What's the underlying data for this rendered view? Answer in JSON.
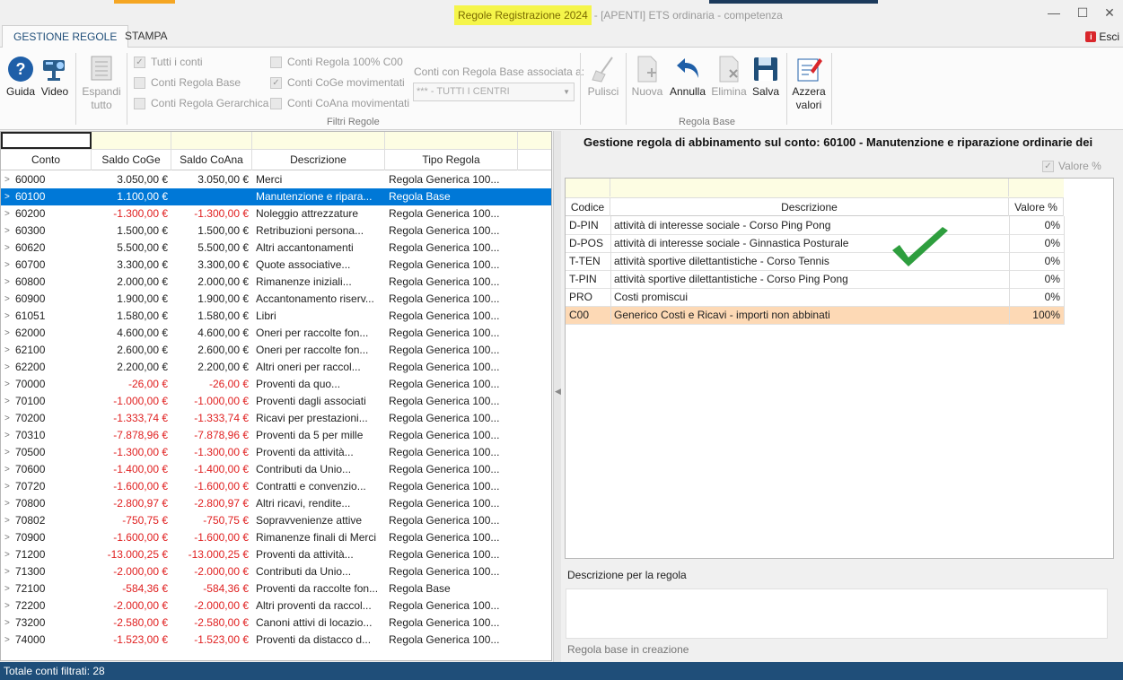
{
  "window": {
    "title_highlight": "Regole Registrazione 2024",
    "title_rest": "- [APENTI] ETS ordinaria - competenza",
    "minimize": "—",
    "maximize": "☐",
    "close": "✕"
  },
  "tabs": [
    {
      "label": "GESTIONE REGOLE",
      "active": true
    },
    {
      "label": "STAMPA",
      "active": false
    }
  ],
  "esci": {
    "label": "Esci",
    "icon": "exit-icon",
    "glyph": "i"
  },
  "ribbon": {
    "guida": "Guida",
    "video": "Video",
    "espandi_line1": "Espandi",
    "espandi_line2": "tutto",
    "filters": {
      "tutti_i_conti": "Tutti i conti",
      "conti_regola_base": "Conti Regola Base",
      "conti_regola_gerarchica": "Conti Regola Gerarchica",
      "conti_regola_100": "Conti Regola 100% C00",
      "conti_coge_mov": "Conti CoGe movimentati",
      "conti_coana_mov": "Conti CoAna movimentati",
      "combo_label": "Conti con Regola Base associata a:",
      "combo_value": "*** - TUTTI I CENTRI",
      "group_label": "Filtri Regole"
    },
    "pulisci": "Pulisci",
    "nuova": "Nuova",
    "annulla": "Annulla",
    "elimina": "Elimina",
    "salva": "Salva",
    "regola_base_group": "Regola Base",
    "azzera_line1": "Azzera",
    "azzera_line2": "valori"
  },
  "grid": {
    "headers": {
      "conto": "Conto",
      "saldo_coge": "Saldo CoGe",
      "saldo_coana": "Saldo CoAna",
      "descrizione": "Descrizione",
      "tipo_regola": "Tipo Regola"
    },
    "rows": [
      {
        "conto": "60000",
        "coge": "3.050,00 €",
        "coana": "3.050,00 €",
        "desc": "Merci",
        "tipo": "Regola Generica 100...",
        "neg": false,
        "exp": ">"
      },
      {
        "conto": "60100",
        "coge": "1.100,00 €",
        "coana": "",
        "desc": "Manutenzione  e  ripara...",
        "tipo": "Regola Base",
        "neg": false,
        "exp": ">",
        "selected": true
      },
      {
        "conto": "60200",
        "coge": "-1.300,00 €",
        "coana": "-1.300,00 €",
        "desc": "Noleggio attrezzature",
        "tipo": "Regola Generica 100...",
        "neg": true,
        "exp": ">"
      },
      {
        "conto": "60300",
        "coge": "1.500,00 €",
        "coana": "1.500,00 €",
        "desc": "Retribuzioni  persona...",
        "tipo": "Regola Generica 100...",
        "neg": false,
        "exp": ">"
      },
      {
        "conto": "60620",
        "coge": "5.500,00 €",
        "coana": "5.500,00 €",
        "desc": "Altri accantonamenti",
        "tipo": "Regola Generica 100...",
        "neg": false,
        "exp": ">"
      },
      {
        "conto": "60700",
        "coge": "3.300,00 €",
        "coana": "3.300,00 €",
        "desc": "Quote associative...",
        "tipo": "Regola Generica 100...",
        "neg": false,
        "exp": ">"
      },
      {
        "conto": "60800",
        "coge": "2.000,00 €",
        "coana": "2.000,00 €",
        "desc": "Rimanenze  iniziali...",
        "tipo": "Regola Generica 100...",
        "neg": false,
        "exp": ">"
      },
      {
        "conto": "60900",
        "coge": "1.900,00 €",
        "coana": "1.900,00 €",
        "desc": "Accantonamento  riserv...",
        "tipo": "Regola Generica 100...",
        "neg": false,
        "exp": ">"
      },
      {
        "conto": "61051",
        "coge": "1.580,00 €",
        "coana": "1.580,00 €",
        "desc": "Libri",
        "tipo": "Regola Generica 100...",
        "neg": false,
        "exp": ">"
      },
      {
        "conto": "62000",
        "coge": "4.600,00 €",
        "coana": "4.600,00 €",
        "desc": "Oneri  per raccolte  fon...",
        "tipo": "Regola Generica 100...",
        "neg": false,
        "exp": ">"
      },
      {
        "conto": "62100",
        "coge": "2.600,00 €",
        "coana": "2.600,00 €",
        "desc": "Oneri per raccolte fon...",
        "tipo": "Regola Generica 100...",
        "neg": false,
        "exp": ">"
      },
      {
        "conto": "62200",
        "coge": "2.200,00 €",
        "coana": "2.200,00 €",
        "desc": "Altri oneri per raccol...",
        "tipo": "Regola Generica 100...",
        "neg": false,
        "exp": ">"
      },
      {
        "conto": "70000",
        "coge": "-26,00 €",
        "coana": "-26,00 €",
        "desc": "Proventi  da quo...",
        "tipo": "Regola Generica 100...",
        "neg": true,
        "exp": ">"
      },
      {
        "conto": "70100",
        "coge": "-1.000,00 €",
        "coana": "-1.000,00 €",
        "desc": "Proventi dagli associati",
        "tipo": "Regola Generica 100...",
        "neg": true,
        "exp": ">"
      },
      {
        "conto": "70200",
        "coge": "-1.333,74 €",
        "coana": "-1.333,74 €",
        "desc": "Ricavi  per  prestazioni...",
        "tipo": "Regola Generica 100...",
        "neg": true,
        "exp": ">"
      },
      {
        "conto": "70310",
        "coge": "-7.878,96 €",
        "coana": "-7.878,96 €",
        "desc": "Proventi  da 5 per mille",
        "tipo": "Regola Generica 100...",
        "neg": true,
        "exp": ">"
      },
      {
        "conto": "70500",
        "coge": "-1.300,00 €",
        "coana": "-1.300,00 €",
        "desc": "Proventi  da attività...",
        "tipo": "Regola Generica 100...",
        "neg": true,
        "exp": ">"
      },
      {
        "conto": "70600",
        "coge": "-1.400,00 €",
        "coana": "-1.400,00 €",
        "desc": "Contributi  da Unio...",
        "tipo": "Regola Generica 100...",
        "neg": true,
        "exp": ">"
      },
      {
        "conto": "70720",
        "coge": "-1.600,00 €",
        "coana": "-1.600,00 €",
        "desc": "Contratti  e  convenzio...",
        "tipo": "Regola Generica 100...",
        "neg": true,
        "exp": ">"
      },
      {
        "conto": "70800",
        "coge": "-2.800,97 €",
        "coana": "-2.800,97 €",
        "desc": "Altri  ricavi,  rendite...",
        "tipo": "Regola Generica 100...",
        "neg": true,
        "exp": ">"
      },
      {
        "conto": "70802",
        "coge": "-750,75 €",
        "coana": "-750,75 €",
        "desc": "Sopravvenienze attive",
        "tipo": "Regola Generica 100...",
        "neg": true,
        "exp": ">"
      },
      {
        "conto": "70900",
        "coge": "-1.600,00 €",
        "coana": "-1.600,00 €",
        "desc": "Rimanenze finali di Merci",
        "tipo": "Regola Generica 100...",
        "neg": true,
        "exp": ">"
      },
      {
        "conto": "71200",
        "coge": "-13.000,25 €",
        "coana": "-13.000,25 €",
        "desc": "Proventi  da attività...",
        "tipo": "Regola Generica 100...",
        "neg": true,
        "exp": ">"
      },
      {
        "conto": "71300",
        "coge": "-2.000,00 €",
        "coana": "-2.000,00 €",
        "desc": "Contributi  da Unio...",
        "tipo": "Regola Generica 100...",
        "neg": true,
        "exp": ">"
      },
      {
        "conto": "72100",
        "coge": "-584,36 €",
        "coana": "-584,36 €",
        "desc": "Proventi da raccolte fon...",
        "tipo": "Regola Base",
        "neg": true,
        "exp": ">"
      },
      {
        "conto": "72200",
        "coge": "-2.000,00 €",
        "coana": "-2.000,00 €",
        "desc": "Altri  proventi  da  raccol...",
        "tipo": "Regola Generica 100...",
        "neg": true,
        "exp": ">"
      },
      {
        "conto": "73200",
        "coge": "-2.580,00 €",
        "coana": "-2.580,00 €",
        "desc": "Canoni  attivi  di  locazio...",
        "tipo": "Regola Generica 100...",
        "neg": true,
        "exp": ">"
      },
      {
        "conto": "74000",
        "coge": "-1.523,00 €",
        "coana": "-1.523,00 €",
        "desc": "Proventi  da distacco  d...",
        "tipo": "Regola Generica 100...",
        "neg": true,
        "exp": ">"
      }
    ]
  },
  "right": {
    "title": "Gestione regola di abbinamento sul conto: 60100 - Manutenzione e riparazione ordinarie dei",
    "valore_pct_label": "Valore %",
    "headers": {
      "codice": "Codice",
      "descrizione": "Descrizione",
      "valore": "Valore %"
    },
    "rows": [
      {
        "code": "D-PIN",
        "desc": "attività di interesse sociale - Corso Ping Pong",
        "val": "0%"
      },
      {
        "code": "D-POS",
        "desc": "attività di interesse sociale - Ginnastica Posturale",
        "val": "0%"
      },
      {
        "code": "T-TEN",
        "desc": "attività sportive dilettantistiche - Corso Tennis",
        "val": "0%"
      },
      {
        "code": "T-PIN",
        "desc": "attività sportive dilettantistiche - Corso Ping Pong",
        "val": "0%"
      },
      {
        "code": "PRO",
        "desc": "Costi promiscui",
        "val": "0%"
      },
      {
        "code": "C00",
        "desc": "Generico Costi e Ricavi - importi non abbinati",
        "val": "100%",
        "highlight": true
      }
    ],
    "desc_label": "Descrizione per la regola",
    "status": "Regola base in creazione",
    "checkmark_color": "#2e9e3e"
  },
  "statusbar": {
    "text": "Totale conti filtrati: 28"
  },
  "colors": {
    "accent_blue": "#0078d7",
    "status_bar": "#1f4e79",
    "negative": "#e02020",
    "highlight_row": "#fdd9b5",
    "filter_row": "#fdfde3",
    "title_highlight": "#f5f54a"
  }
}
